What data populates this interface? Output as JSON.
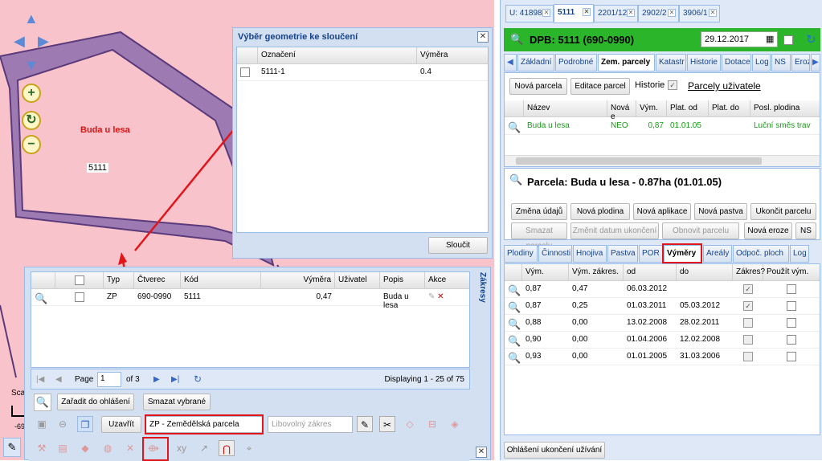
{
  "map": {
    "parcel_label": "Buda u lesa",
    "parcel_number": "5111",
    "scale_label": "Sca",
    "negative_coord": "-69",
    "colors": {
      "background": "#f9c3cb",
      "parcel_fill": "#9d7ab2",
      "parcel_border": "#5a3a7a",
      "label": "#dd1111"
    }
  },
  "merge_dialog": {
    "title": "Výběr geometrie ke sloučení",
    "columns": [
      "Označení",
      "Výměra"
    ],
    "rows": [
      {
        "code": "5111-1",
        "area": "0.4"
      }
    ],
    "merge_button": "Sloučit"
  },
  "lower_panel": {
    "side_title": "Zákresy",
    "columns": [
      "Typ",
      "Čtverec",
      "Kód",
      "Výměra",
      "Uživatel",
      "Popis",
      "Akce"
    ],
    "rows": [
      {
        "type": "ZP",
        "square": "690-0990",
        "code": "5111",
        "area": "0,47",
        "user": "",
        "description": "Buda u lesa"
      }
    ],
    "pager": {
      "page_label": "Page",
      "page_value": "1",
      "of_label": "of 3",
      "displaying": "Displaying 1 - 25 of 75"
    },
    "actions": {
      "add_to_report": "Zařadit do ohlášení",
      "delete_selected": "Smazat vybrané"
    },
    "toolbar": {
      "close_button": "Uzavřít",
      "type_select": "ZP - Zemědělská parcela",
      "drawing_select": "Libovolný zákres"
    }
  },
  "right_panel": {
    "doc_tabs": [
      {
        "label": "U: 41898"
      },
      {
        "label": "5111"
      },
      {
        "label": "2201/12"
      },
      {
        "label": "2902/2"
      },
      {
        "label": "3906/1"
      }
    ],
    "dpb": {
      "title": "DPB: 5111 (690-0990)",
      "date": "29.12.2017"
    },
    "sub_tabs": [
      "Základní",
      "Podrobné",
      "Zem. parcely",
      "Katastr",
      "Historie",
      "Dotace",
      "Log",
      "NS",
      "Eroz"
    ],
    "parcel_toolbar": {
      "new_parcel": "Nová parcela",
      "edit_parcel": "Editace parcel",
      "history_label": "Historie",
      "user_parcels": "Parcely uživatele"
    },
    "parcel_grid": {
      "columns": [
        "Název",
        "Nová e",
        "Vým.",
        "Plat. od",
        "Plat. do",
        "Posl. plodina"
      ],
      "rows": [
        {
          "name": "Buda u lesa",
          "new": "NEO",
          "area": "0,87",
          "from": "01.01.05",
          "to": "",
          "last_crop": "Luční směs trav"
        }
      ]
    },
    "parcel_detail": {
      "title": "Parcela: Buda u lesa - 0.87ha (01.01.05)",
      "buttons_row1": [
        "Změna údajů",
        "Nová plodina",
        "Nová aplikace",
        "Nová pastva",
        "Ukončit parcelu"
      ],
      "buttons_row2": [
        "Smazat parcelu",
        "Změnit datum ukončení",
        "Obnovit parcelu",
        "Nová eroze",
        "NS"
      ]
    },
    "detail_tabs": [
      "Plodiny",
      "Činnosti",
      "Hnojiva",
      "Pastva",
      "POR",
      "Výměry",
      "Areály",
      "Odpoč. ploch",
      "Log"
    ],
    "vymery_grid": {
      "columns": [
        "Vým.",
        "Vým. zákres.",
        "od",
        "do",
        "Zákres?",
        "Použít vým."
      ],
      "rows": [
        {
          "area": "0,87",
          "drawn": "0,47",
          "from": "06.03.2012",
          "to": ""
        },
        {
          "area": "0,87",
          "drawn": "0,25",
          "from": "01.03.2011",
          "to": "05.03.2012"
        },
        {
          "area": "0,88",
          "drawn": "0,00",
          "from": "13.02.2008",
          "to": "28.02.2011"
        },
        {
          "area": "0,90",
          "drawn": "0,00",
          "from": "01.04.2006",
          "to": "12.02.2008"
        },
        {
          "area": "0,93",
          "drawn": "0,00",
          "from": "01.01.2005",
          "to": "31.03.2006"
        }
      ]
    },
    "bottom_button": "Ohlášení ukončení užívání",
    "colors": {
      "green_bar": "#2bb52b",
      "accent": "#15428b",
      "highlight": "#e0161b"
    }
  }
}
